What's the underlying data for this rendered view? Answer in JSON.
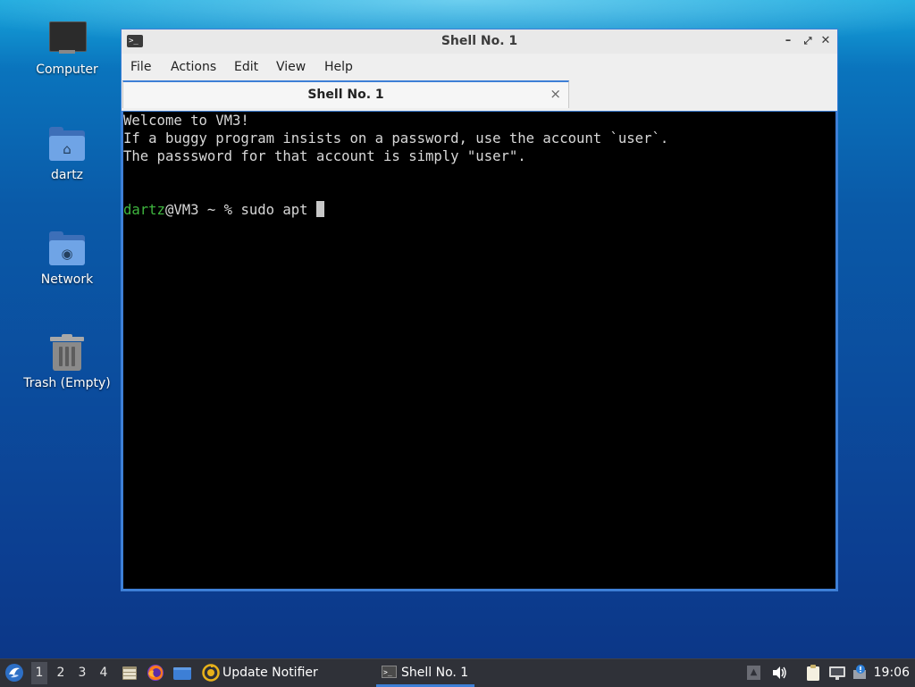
{
  "desktop": {
    "icons": [
      {
        "label": "Computer"
      },
      {
        "label": "dartz"
      },
      {
        "label": "Network"
      },
      {
        "label": "Trash (Empty)"
      }
    ]
  },
  "window": {
    "title": "Shell No. 1",
    "menu": [
      "File",
      "Actions",
      "Edit",
      "View",
      "Help"
    ],
    "tab": {
      "title": "Shell No. 1",
      "close_glyph": "×"
    },
    "controls": {
      "minimize": "–",
      "maximize": "⤢",
      "close": "✕"
    },
    "terminal": {
      "lines": [
        "Welcome to VM3!",
        "If a buggy program insists on a password, use the account `user`.",
        "The passsword for that account is simply \"user\"."
      ],
      "prompt_user": "dartz",
      "prompt_rest": "@VM3 ~ % ",
      "command": "sudo apt "
    }
  },
  "taskbar": {
    "workspaces": [
      "1",
      "2",
      "3",
      "4"
    ],
    "active_workspace": "1",
    "tasks": [
      {
        "label": "Update Notifier",
        "icon": "update-notifier-icon"
      },
      {
        "label": "Shell No. 1",
        "icon": "terminal-icon"
      }
    ],
    "clock": "19:06"
  },
  "colors": {
    "accent": "#3d7fd6",
    "prompt_user": "#3fb63f",
    "terminal_bg": "#000000",
    "taskbar_bg": "#2f3138"
  }
}
